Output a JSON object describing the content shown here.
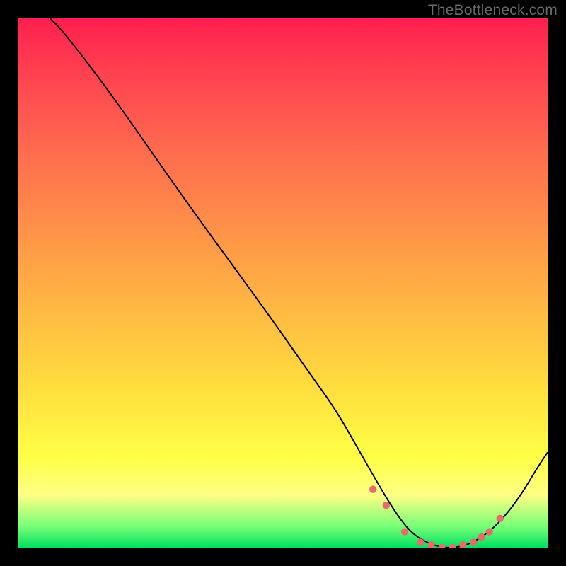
{
  "watermark": "TheBottleneck.com",
  "colors": {
    "curve": "#000000",
    "marker": "#e96a6a",
    "gradient_top": "#ff1f4f",
    "gradient_bottom": "#00e060"
  },
  "chart_data": {
    "type": "line",
    "title": "",
    "xlabel": "",
    "ylabel": "",
    "xlim": [
      0,
      100
    ],
    "ylim": [
      0,
      100
    ],
    "x": [
      6,
      8,
      12,
      18,
      25,
      32,
      40,
      48,
      55,
      60,
      64,
      68,
      71,
      74,
      77,
      80,
      83,
      86,
      89,
      92,
      95,
      98,
      100
    ],
    "values": [
      100,
      98,
      93,
      85,
      75,
      65,
      54,
      43,
      33,
      26,
      19,
      12,
      7,
      3,
      1,
      0,
      0,
      1,
      3,
      6,
      10,
      15,
      18
    ],
    "markers": {
      "x": [
        67,
        69.5,
        73,
        76,
        78,
        80,
        82,
        84,
        86,
        87.5,
        89,
        91
      ],
      "values": [
        11,
        8,
        3,
        1,
        0.5,
        0,
        0,
        0.5,
        1,
        2,
        3,
        5.5
      ]
    }
  }
}
